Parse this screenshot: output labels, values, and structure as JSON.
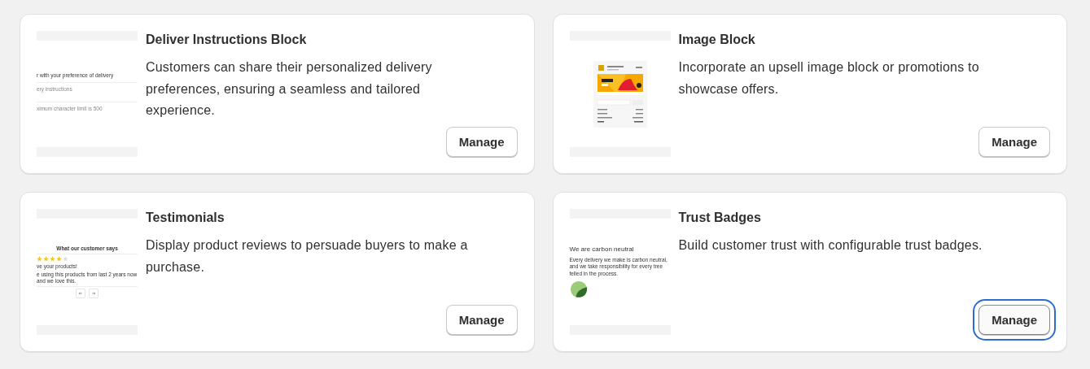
{
  "cards": [
    {
      "title": "Deliver Instructions Block",
      "description": "Customers can share their personalized delivery preferences, ensuring a seamless and tailored experience.",
      "button": "Manage",
      "focused": false,
      "preview": {
        "kind": "form",
        "heading": "r with your preference of delivery",
        "field": "ery instructions",
        "hint": "ximum character limit is 500"
      }
    },
    {
      "title": "Image Block",
      "description": "Incorporate an upsell image block or promotions to showcase offers.",
      "button": "Manage",
      "focused": false,
      "preview": {
        "kind": "upsell"
      }
    },
    {
      "title": "Testimonials",
      "description": "Display product reviews to persuade buyers to make a purchase.",
      "button": "Manage",
      "focused": false,
      "preview": {
        "kind": "reviews",
        "heading": "What our customer says",
        "stars": 4,
        "quote_title": "ve your products!",
        "quote": "e using this products from last 2 years now and we love this."
      }
    },
    {
      "title": "Trust Badges",
      "description": "Build customer trust with configurable trust badges.",
      "button": "Manage",
      "focused": true,
      "preview": {
        "kind": "badge",
        "heading": "We are carbon neutral",
        "text": "Every delivery we make is carbon neutral, and we take responsibility for every tree felled in the process."
      }
    }
  ]
}
